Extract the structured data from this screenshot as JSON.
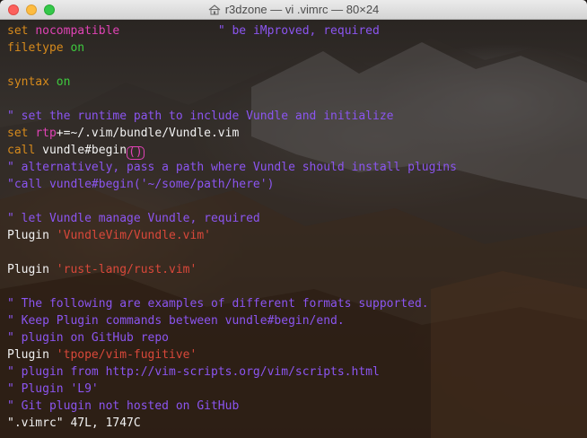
{
  "window": {
    "title": "r3dzone — vi .vimrc — 80×24",
    "title_icon": "home-folder-icon"
  },
  "colors": {
    "comment": "#8b55f0",
    "statement": "#d68a1c",
    "keyword": "#e043b5",
    "constant": "#3ec93e",
    "string": "#d9483a",
    "normal": "#f2f2f2"
  },
  "editor": {
    "lines": [
      [
        {
          "t": "set",
          "c": "statement"
        },
        {
          "t": " ",
          "c": "normal"
        },
        {
          "t": "nocompatible",
          "c": "keyword"
        },
        {
          "t": "              ",
          "c": "normal"
        },
        {
          "t": "\" be iMproved, required",
          "c": "comment"
        }
      ],
      [
        {
          "t": "filetype",
          "c": "statement"
        },
        {
          "t": " ",
          "c": "normal"
        },
        {
          "t": "on",
          "c": "constant"
        }
      ],
      [],
      [
        {
          "t": "syntax",
          "c": "statement"
        },
        {
          "t": " ",
          "c": "normal"
        },
        {
          "t": "on",
          "c": "constant"
        }
      ],
      [],
      [
        {
          "t": "\" set the runtime path to include Vundle and initialize",
          "c": "comment"
        }
      ],
      [
        {
          "t": "set",
          "c": "statement"
        },
        {
          "t": " ",
          "c": "normal"
        },
        {
          "t": "rtp",
          "c": "keyword"
        },
        {
          "t": "+=~/.vim/bundle/Vundle.vim",
          "c": "normal"
        }
      ],
      [
        {
          "t": "call",
          "c": "statement"
        },
        {
          "t": " vundle#begin",
          "c": "normal"
        },
        {
          "t": "()",
          "c": "paren"
        }
      ],
      [
        {
          "t": "\" alternatively, pass a path where Vundle should install plugins",
          "c": "comment"
        }
      ],
      [
        {
          "t": "\"call vundle#begin('~/some/path/here')",
          "c": "comment"
        }
      ],
      [],
      [
        {
          "t": "\" let Vundle manage Vundle, required",
          "c": "comment"
        }
      ],
      [
        {
          "t": "Plugin ",
          "c": "normal"
        },
        {
          "t": "'VundleVim/Vundle.vim'",
          "c": "string"
        }
      ],
      [],
      [
        {
          "t": "Plugin ",
          "c": "normal"
        },
        {
          "t": "'rust-lang/rust.vim'",
          "c": "string"
        }
      ],
      [],
      [
        {
          "t": "\" The following are examples of different formats supported.",
          "c": "comment"
        }
      ],
      [
        {
          "t": "\" Keep Plugin commands between vundle#begin/end.",
          "c": "comment"
        }
      ],
      [
        {
          "t": "\" plugin on GitHub repo",
          "c": "comment"
        }
      ],
      [
        {
          "t": "Plugin ",
          "c": "normal"
        },
        {
          "t": "'tpope/vim-fugitive'",
          "c": "string"
        }
      ],
      [
        {
          "t": "\" plugin from http://vim-scripts.org/vim/scripts.html",
          "c": "comment"
        }
      ],
      [
        {
          "t": "\" Plugin 'L9'",
          "c": "comment"
        }
      ],
      [
        {
          "t": "\" Git plugin not hosted on GitHub",
          "c": "comment"
        }
      ],
      [
        {
          "t": "\".vimrc\" 47L, 1747C",
          "c": "plain"
        }
      ]
    ]
  }
}
